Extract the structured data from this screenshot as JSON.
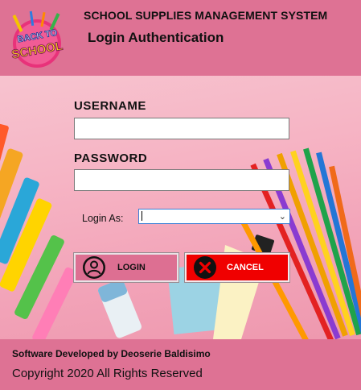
{
  "header": {
    "app_title": "SCHOOL SUPPLIES MANAGEMENT SYSTEM",
    "subtitle": "Login Authentication",
    "logo_text_top": "BACK TO",
    "logo_text_bottom": "SCHOOL"
  },
  "form": {
    "username_label": "USERNAME",
    "username_value": "",
    "password_label": "PASSWORD",
    "password_value": "",
    "login_as_label": "Login As:",
    "login_as_value": ""
  },
  "buttons": {
    "login_label": "LOGIN",
    "cancel_label": "CANCEL"
  },
  "footer": {
    "developer": "Software Developed by Deoserie Baldisimo",
    "copyright": "Copyright 2020 All Rights Reserved"
  },
  "colors": {
    "header_bg": "#de7294",
    "login_button": "#dd6f92",
    "cancel_button": "#f00000"
  }
}
